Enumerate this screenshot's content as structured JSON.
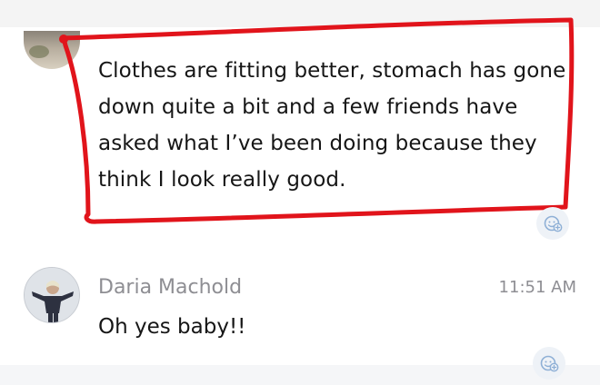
{
  "messages": [
    {
      "text": "Clothes are fitting better, stomach has gone down quite a bit and a few friends have asked what I’ve been doing because they think I look really good."
    },
    {
      "author": "Daria Machold",
      "time": "11:51 AM",
      "text": "Oh yes baby!!"
    }
  ],
  "icons": {
    "reaction": "add-reaction-icon",
    "avatar_partial": "user-avatar",
    "avatar": "daria-avatar"
  },
  "colors": {
    "highlight": "#e1141b",
    "muted_text": "#8e8e93",
    "reaction_bg": "#eef2f7",
    "reaction_icon": "#8fb0d6"
  }
}
